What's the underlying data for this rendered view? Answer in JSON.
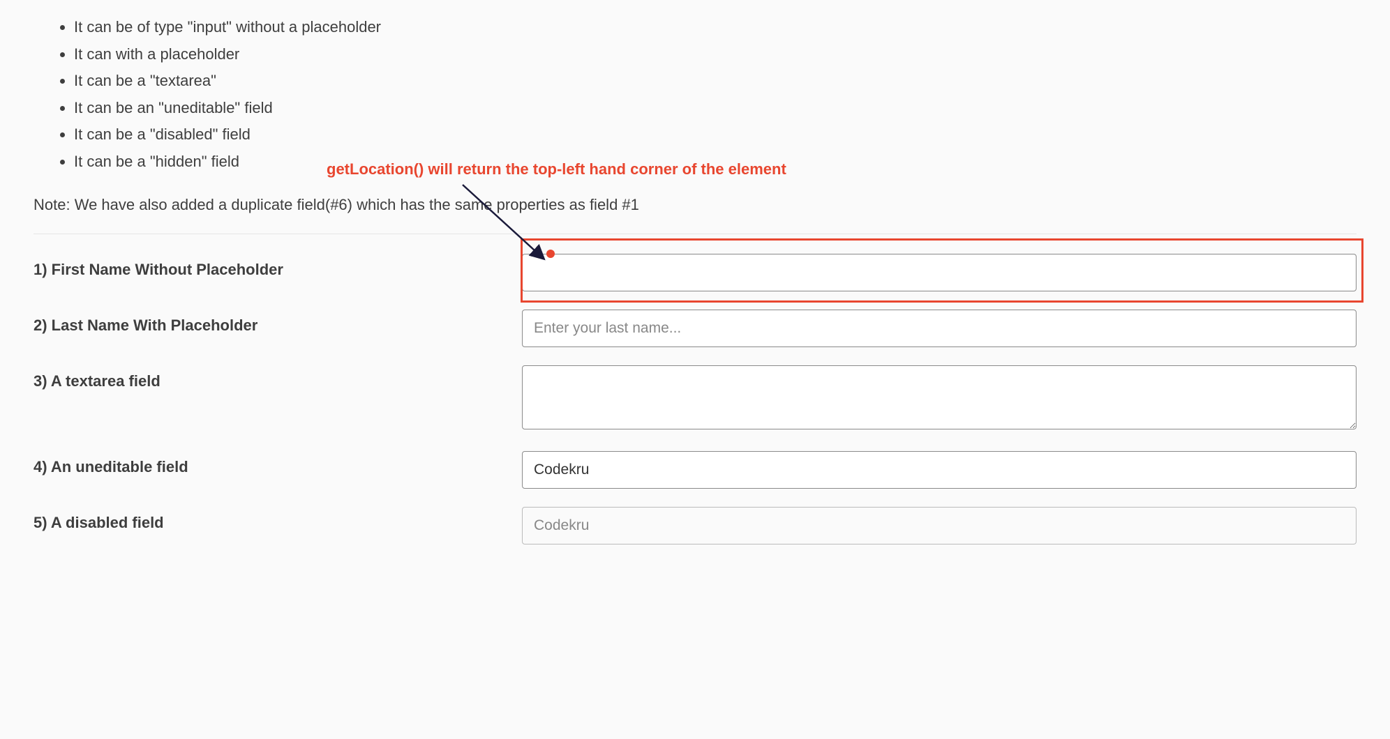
{
  "bullets": [
    "It can be of type \"input\" without a placeholder",
    "It can with a placeholder",
    "It can be a \"textarea\"",
    "It can be an \"uneditable\" field",
    "It can be a \"disabled\" field",
    "It can be a \"hidden\" field"
  ],
  "annotation": "getLocation() will return the top-left hand corner of the element",
  "note": "Note: We have also added a duplicate field(#6) which has the same properties as field #1",
  "fields": {
    "f1": {
      "label": "1) First Name Without Placeholder",
      "value": "",
      "placeholder": ""
    },
    "f2": {
      "label": "2) Last Name With Placeholder",
      "value": "",
      "placeholder": "Enter your last name..."
    },
    "f3": {
      "label": "3) A textarea field",
      "value": ""
    },
    "f4": {
      "label": "4) An uneditable field",
      "value": "Codekru"
    },
    "f5": {
      "label": "5) A disabled field",
      "value": "Codekru"
    }
  }
}
